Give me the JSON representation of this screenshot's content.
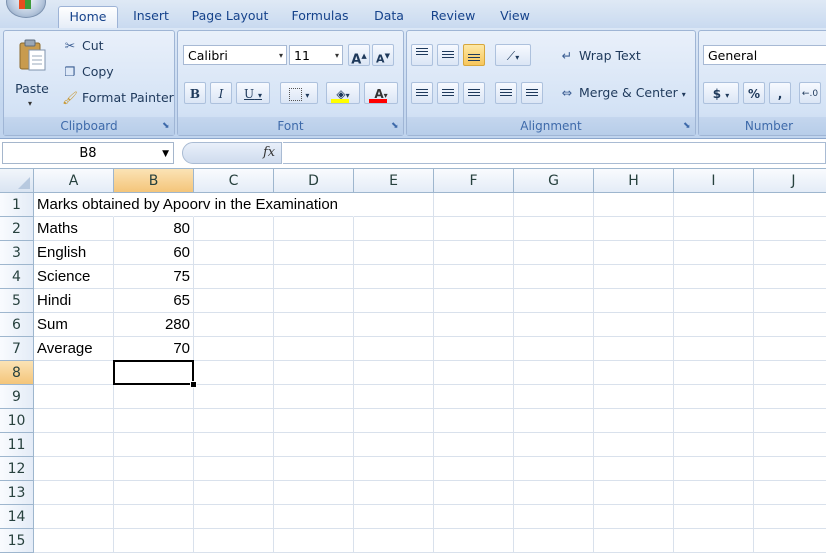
{
  "ribbon_tabs": [
    "Home",
    "Insert",
    "Page Layout",
    "Formulas",
    "Data",
    "Review",
    "View"
  ],
  "active_tab": "Home",
  "clipboard": {
    "paste": "Paste",
    "cut": "Cut",
    "copy": "Copy",
    "format_painter": "Format Painter",
    "label": "Clipboard"
  },
  "font": {
    "name": "Calibri",
    "size": "11",
    "bold": "B",
    "italic": "I",
    "underline": "U",
    "color_letter": "A",
    "grow": "A",
    "shrink": "A",
    "label": "Font"
  },
  "alignment": {
    "wrap_text": "Wrap Text",
    "merge_center": "Merge & Center",
    "label": "Alignment"
  },
  "number": {
    "format": "General",
    "currency": "$",
    "percent": "%",
    "comma": ",",
    "label": "Number"
  },
  "formula_bar": {
    "name_box": "B8",
    "fx": "fx",
    "content": ""
  },
  "columns": [
    "A",
    "B",
    "C",
    "D",
    "E",
    "F",
    "G",
    "H",
    "I",
    "J"
  ],
  "rows": [
    "1",
    "2",
    "3",
    "4",
    "5",
    "6",
    "7",
    "8",
    "9",
    "10",
    "11",
    "12",
    "13",
    "14",
    "15"
  ],
  "sheet": {
    "title": "Marks obtained by Apoorv in the Examination",
    "records": [
      {
        "label": "Maths",
        "value": "80"
      },
      {
        "label": "English",
        "value": "60"
      },
      {
        "label": "Science",
        "value": "75"
      },
      {
        "label": "Hindi",
        "value": "65"
      },
      {
        "label": "Sum",
        "value": "280"
      },
      {
        "label": "Average",
        "value": "70"
      }
    ]
  },
  "selected_cell": "B8",
  "colors": {
    "selection_header": "#f4c57a",
    "font_color_bar": "#ff0000",
    "fill_color_bar": "#ffff00"
  }
}
